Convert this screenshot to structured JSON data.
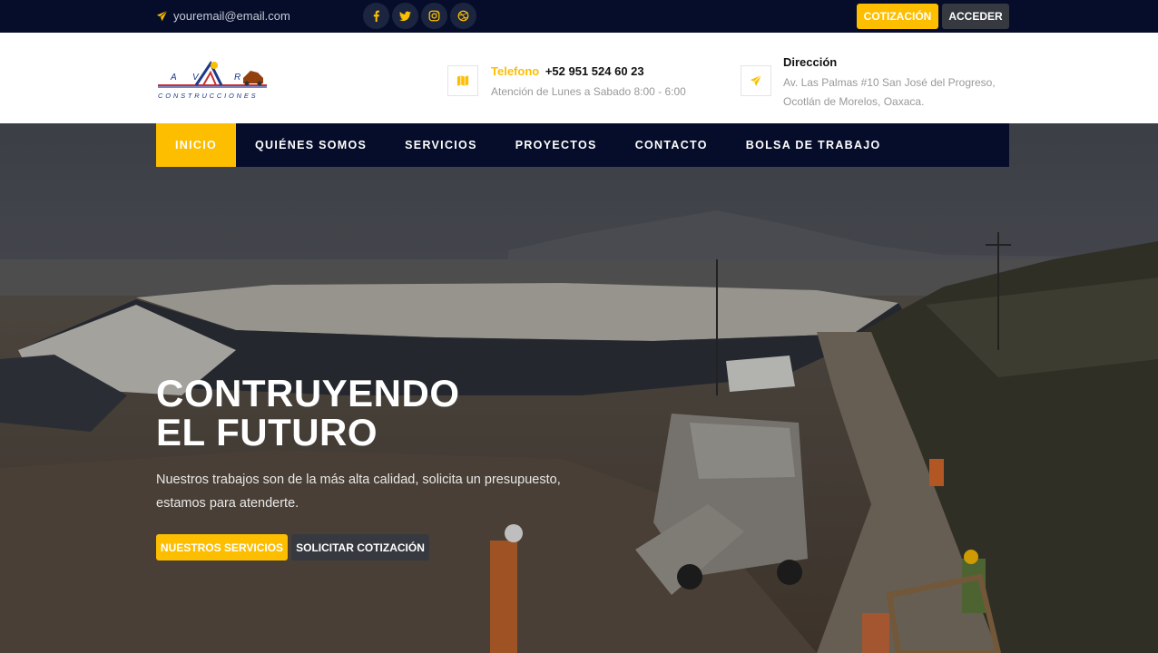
{
  "topbar": {
    "email": "youremail@email.com",
    "socials": [
      {
        "icon": "facebook-icon"
      },
      {
        "icon": "twitter-icon"
      },
      {
        "icon": "instagram-icon"
      },
      {
        "icon": "dribbble-icon"
      }
    ],
    "cotizacion_label": "COTIZACIÓN",
    "acceder_label": "ACCEDER"
  },
  "header": {
    "logo_letters": "A V R",
    "logo_word": "CONSTRUCCIONES",
    "telefono_label": "Telefono",
    "telefono_number": "+52 951 524 60 23",
    "telefono_hours": "Atención de Lunes a Sabado 8:00 - 6:00",
    "direccion_title": "Dirección",
    "direccion_text": "Av. Las Palmas #10 San José del Progreso, Ocotlán de Morelos, Oaxaca."
  },
  "nav": {
    "items": [
      "INICIO",
      "QUIÉNES SOMOS",
      "SERVICIOS",
      "PROYECTOS",
      "CONTACTO",
      "BOLSA DE TRABAJO"
    ],
    "active": 0
  },
  "hero": {
    "title_line1": "CONTRUYENDO",
    "title_line2": "EL FUTURO",
    "text": "Nuestros trabajos son de la más alta calidad, solicita un presupuesto, estamos para atenderte.",
    "btn_servicios": "NUESTROS SERVICIOS",
    "btn_cotizacion": "SOLICITAR COTIZACIÓN"
  },
  "colors": {
    "accent": "#fdbe00",
    "dark": "#060d2a",
    "button_dark": "#363940"
  }
}
